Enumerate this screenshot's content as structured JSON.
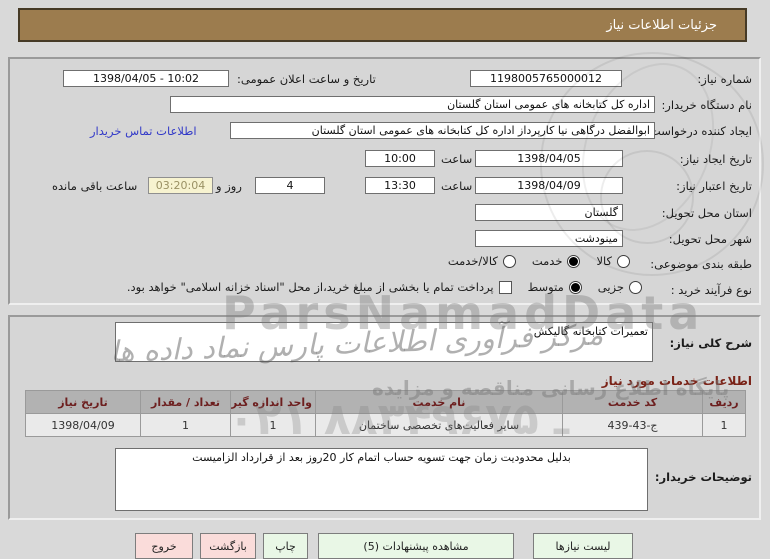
{
  "banner": {
    "title": "جزئیات اطلاعات نیاز"
  },
  "form": {
    "need_number": {
      "label": "شماره نیاز:",
      "value": "1198005765000012"
    },
    "announce_datetime": {
      "label": "تاریخ و ساعت اعلان عمومی:",
      "value": "1398/04/05 - 10:02"
    },
    "buyer_org": {
      "label": "نام دستگاه خریدار:",
      "value": "اداره کل کتابخانه های عمومی استان گلستان"
    },
    "request_creator": {
      "label": "ایجاد کننده درخواست:",
      "value": "ابوالفضل  درگاهی نیا کارپرداز اداره کل کتابخانه های عمومی استان گلستان"
    },
    "buyer_contact_link": "اطلاعات تماس خریدار",
    "need_create": {
      "label": "تاریخ ایجاد نیاز:",
      "date": "1398/04/05",
      "hour_label": "ساعت",
      "time": "10:00"
    },
    "need_expire": {
      "label": "تاریخ اعتبار نیاز:",
      "date": "1398/04/09",
      "hour_label": "ساعت",
      "time": "13:30"
    },
    "remaining": {
      "days": "4",
      "days_label": "روز و",
      "time": "03:20:04",
      "suffix_label": "ساعت باقی مانده"
    },
    "delivery_province": {
      "label": "استان محل تحویل:",
      "value": "گلستان"
    },
    "delivery_city": {
      "label": "شهر محل تحویل:",
      "value": "مینودشت"
    },
    "subject_class": {
      "label": "طبقه بندی موضوعی:",
      "options": [
        {
          "label": "کالا",
          "checked": false
        },
        {
          "label": "خدمت",
          "checked": true
        },
        {
          "label": "کالا/خدمت",
          "checked": false
        }
      ]
    },
    "purchase_type": {
      "label": "نوع فرآیند خرید :",
      "options": [
        {
          "label": "جزیی",
          "checked": false
        },
        {
          "label": "متوسط",
          "checked": true
        }
      ],
      "treasury_checkbox": {
        "checked": false,
        "label": "پرداخت تمام یا بخشی از مبلغ خرید،از محل \"اسناد خزانه اسلامی\" خواهد بود."
      }
    }
  },
  "description": {
    "label": "شرح کلی نیاز:",
    "value": "تعمیرات کتابخانه گالیکش"
  },
  "services": {
    "header": "اطلاعات خدمات مورد نیاز",
    "columns": [
      "ردیف",
      "کد خدمت",
      "نام خدمت",
      "واحد اندازه گیری",
      "تعداد / مقدار",
      "تاریخ نیاز"
    ],
    "rows": [
      [
        "1",
        "ج-43-439",
        "سایر فعالیت‌های تخصصی ساختمان",
        "1",
        "1",
        "1398/04/09"
      ]
    ]
  },
  "buyer_notes": {
    "label": "توضیحات خریدار:",
    "value": "بدلیل محدودیت زمان جهت تسویه حساب اتمام کار 20روز بعد از قرارداد الزامیست"
  },
  "footer": {
    "buttons": [
      {
        "label": "خروج",
        "style": "pink"
      },
      {
        "label": "بازگشت",
        "style": "pink"
      },
      {
        "label": "چاپ",
        "style": "green"
      },
      {
        "label": "مشاهده پیشنهادات (5)",
        "style": "green"
      },
      {
        "label": "لیست نیازها",
        "style": "green"
      }
    ]
  },
  "watermarks": {
    "brand_latin": "ParsNamadData",
    "brand_script": "مرکز فرآوری اطلاعات پارس نماد داده ها",
    "portal_line": "پایگاه اطلاع رسانی مناقصه و مزایده",
    "phone": "۰۲۱ ـ ۸۸۳۴۹۶۷۵"
  },
  "colors": {
    "banner_bg": "#9c7c4e",
    "link_blue": "#3239c8",
    "header_maroon": "#7a2318",
    "countdown_bg": "#f7f3d0"
  }
}
